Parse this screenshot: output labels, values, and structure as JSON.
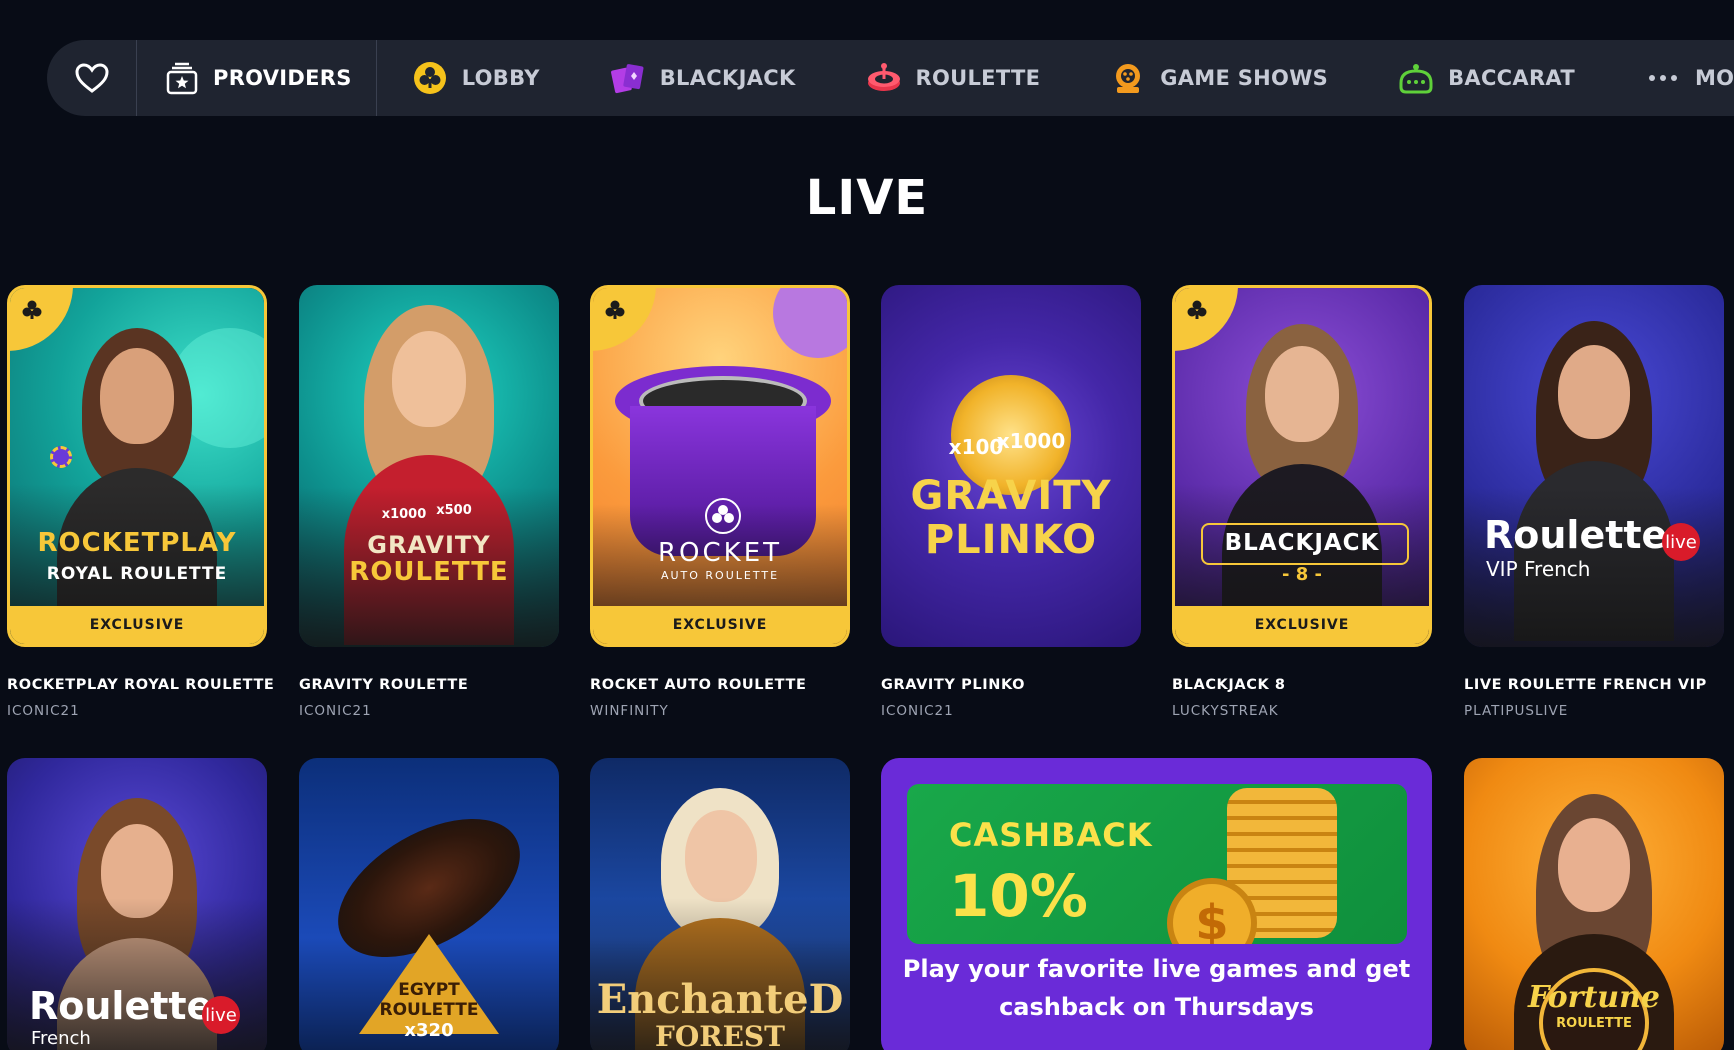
{
  "nav": {
    "providers": "PROVIDERS",
    "items": [
      {
        "label": "LOBBY",
        "icon": "club-coin-icon"
      },
      {
        "label": "BLACKJACK",
        "icon": "cards-icon"
      },
      {
        "label": "ROULETTE",
        "icon": "roulette-icon"
      },
      {
        "label": "GAME SHOWS",
        "icon": "game-show-icon"
      },
      {
        "label": "BACCARAT",
        "icon": "baccarat-icon"
      },
      {
        "label": "MORE",
        "icon": "more-dots-icon"
      }
    ]
  },
  "page": {
    "title": "LIVE"
  },
  "games_row1": [
    {
      "name": "ROCKETPLAY ROYAL ROULETTE",
      "provider": "ICONIC21",
      "exclusive": "EXCLUSIVE",
      "logo_line1": "ROCKETPLAY",
      "logo_line2": "ROYAL ROULETTE"
    },
    {
      "name": "GRAVITY ROULETTE",
      "provider": "ICONIC21",
      "logo_line1": "GRAVITY",
      "logo_line2": "ROULETTE",
      "badge1": "x1000",
      "badge2": "x500"
    },
    {
      "name": "ROCKET AUTO ROULETTE",
      "provider": "WINFINITY",
      "exclusive": "EXCLUSIVE",
      "logo_line1": "ROCKET",
      "logo_line2": "AUTO ROULETTE"
    },
    {
      "name": "GRAVITY PLINKO",
      "provider": "ICONIC21",
      "logo_line1": "GRAVITY",
      "logo_line2": "PLINKO",
      "badge1": "x100",
      "badge2": "x1000"
    },
    {
      "name": "BLACKJACK 8",
      "provider": "LUCKYSTREAK",
      "exclusive": "EXCLUSIVE",
      "logo_line1": "BLACKJACK",
      "logo_line2": "- 8 -"
    },
    {
      "name": "LIVE ROULETTE FRENCH VIP",
      "provider": "PLATIPUSLIVE",
      "logo_line1": "Roulette",
      "logo_line2": "VIP French",
      "live_badge": "live"
    }
  ],
  "games_row2": [
    {
      "logo_line1": "Roulette",
      "logo_line2": "French",
      "live_badge": "live"
    },
    {
      "logo_line1": "EGYPT",
      "logo_line2": "ROULETTE",
      "logo_line3": "x320"
    },
    {
      "logo_line1": "EnchanteD",
      "logo_line2": "FOREST"
    },
    {
      "logo_line1": "Fortune",
      "logo_line2": "ROULETTE"
    }
  ],
  "promo": {
    "title": "CASHBACK",
    "percent": "10%",
    "text_line1": "Play your favorite live games and get",
    "text_line2": "cashback on Thursdays"
  }
}
